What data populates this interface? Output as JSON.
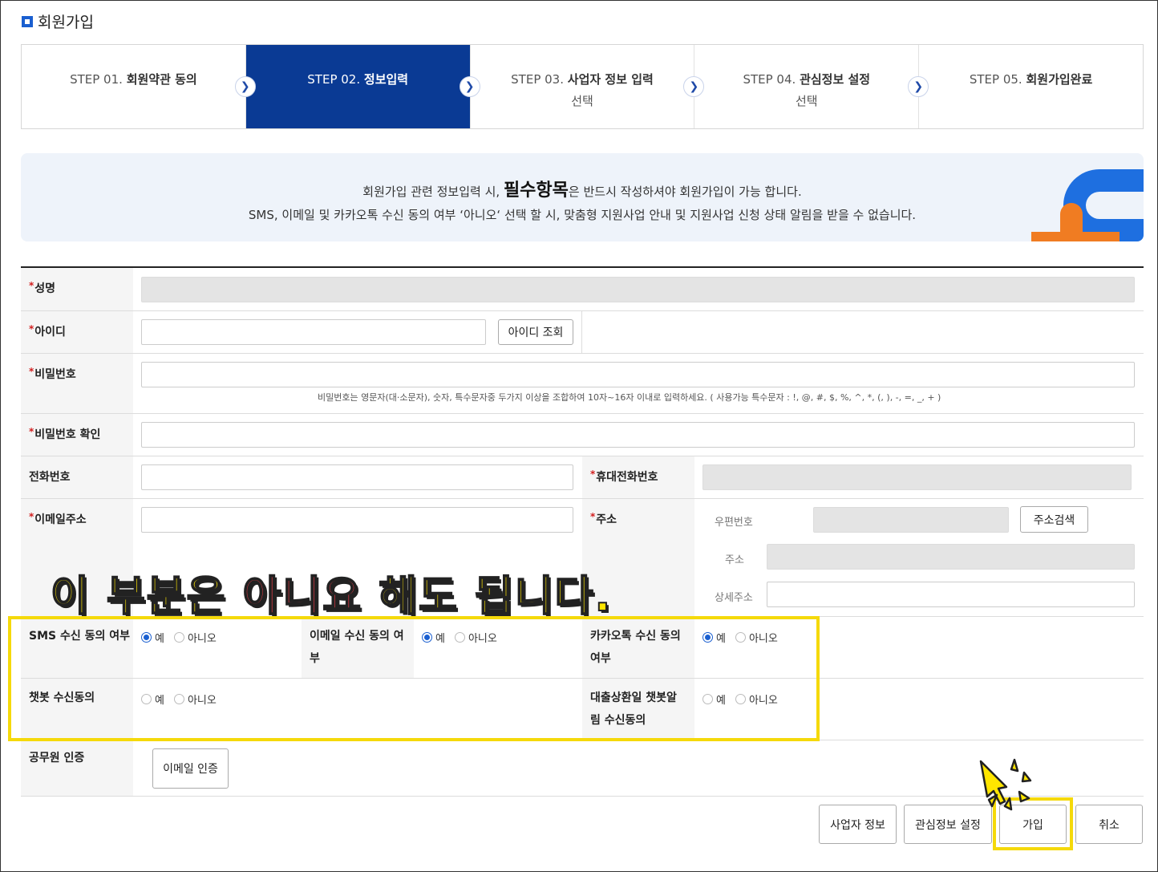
{
  "page": {
    "title": "회원가입"
  },
  "steps": [
    {
      "num": "STEP 01.",
      "title": "회원약관 동의",
      "sub": ""
    },
    {
      "num": "STEP 02.",
      "title": "정보입력",
      "sub": ""
    },
    {
      "num": "STEP 03.",
      "title": "사업자 정보 입력",
      "sub": "선택"
    },
    {
      "num": "STEP 04.",
      "title": "관심정보 설정",
      "sub": "선택"
    },
    {
      "num": "STEP 05.",
      "title": "회원가입완료",
      "sub": ""
    }
  ],
  "notice": {
    "line1_pre": "회원가입 관련 정보입력 시, ",
    "line1_emph": "필수항목",
    "line1_post": "은 반드시 작성하셔야 회원가입이 가능 합니다.",
    "line2": "SMS, 이메일 및 카카오톡 수신 동의 여부 ‘아니오‘ 선택 할 시, 맞춤형 지원사업 안내 및 지원사업 신청 상태 알림을 받을 수 없습니다."
  },
  "form": {
    "required_mark": "*",
    "name_label": "성명",
    "id_label": "아이디",
    "id_check_button": "아이디 조회",
    "password_label": "비밀번호",
    "password_hint": "비밀번호는 영문자(대·소문자), 숫자, 특수문자중 두가지 이상을 조합하여 10자~16자 이내로 입력하세요. ( 사용가능 특수문자 : !, @, #, $, %, ^, *, (, ), -, =, _, + )",
    "password_confirm_label": "비밀번호 확인",
    "phone_label": "전화번호",
    "mobile_label": "휴대전화번호",
    "email_label": "이메일주소",
    "address_label": "주소",
    "postcode_label": "우편번호",
    "address_search_button": "주소검색",
    "address_sub_label": "주소",
    "address_detail_label": "상세주소",
    "sms_label": "SMS 수신 동의 여부",
    "email_consent_label": "이메일 수신 동의 여부",
    "kakao_label": "카카오톡 수신 동의 여부",
    "chatbot_label": "챗봇 수신동의",
    "loan_chatbot_label": "대출상환일 챗봇알림 수신동의",
    "yes": "예",
    "no": "아니오",
    "sms_value": "예",
    "email_consent_value": "예",
    "kakao_value": "예",
    "chatbot_value": "",
    "loan_chatbot_value": "",
    "civil_label": "공무원 인증",
    "email_verify_button": "이메일 인증"
  },
  "actions": {
    "business_info": "사업자 정보",
    "interest_settings": "관심정보 설정",
    "join": "가입",
    "cancel": "취소"
  },
  "annotation": {
    "text_pre": "이 부분은 ",
    "text_emph": "아니요",
    "text_post": " 해도 됩니다."
  },
  "colors": {
    "active_step": "#0a3a94",
    "required": "#d21e1e",
    "highlight": "#f5d90a",
    "accent": "#1a5fd0"
  }
}
